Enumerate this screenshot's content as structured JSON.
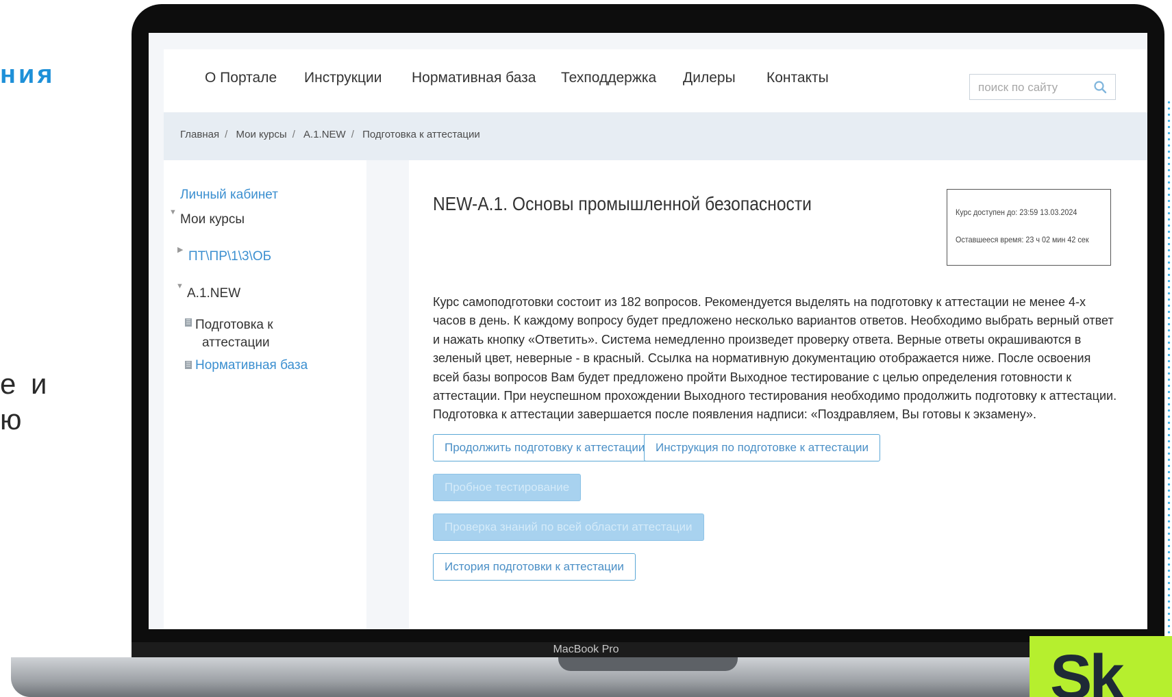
{
  "slide": {
    "fragment_top": "ния",
    "fragment_mid_line1": "е и",
    "fragment_mid_line2": "ю",
    "macbook_label": "MacBook Pro",
    "logo_text": "Sk"
  },
  "nav": {
    "items": [
      "О Портале",
      "Инструкции",
      "Нормативная база",
      "Техподдержка",
      "Дилеры",
      "Контакты"
    ],
    "search_placeholder": "поиск по сайту"
  },
  "breadcrumb": [
    "Главная",
    "Мои курсы",
    "А.1.NEW",
    "Подготовка к аттестации"
  ],
  "sidebar": {
    "cabinet": "Личный кабинет",
    "my_courses": "Мои курсы",
    "course_1": "ПТ\\ПР\\1\\3\\ОБ",
    "course_2": "А.1.NEW",
    "item_prep_line1": "Подготовка к",
    "item_prep_line2": "аттестации",
    "item_normative": "Нормативная база"
  },
  "main": {
    "title": "NEW-А.1. Основы промышленной безопасности",
    "available_until": "Курс доступен до: 23:59 13.03.2024",
    "remaining_time": "Оставшееся время: 23 ч 02 мин 42 сек",
    "description": "Курс самоподготовки состоит из 182 вопросов. Рекомендуется выделять на подготовку к аттестации не менее 4-х часов в день. К каждому вопросу будет предложено несколько вариантов ответов. Необходимо выбрать верный ответ и нажать кнопку «Ответить». Система немедленно произведет проверку ответа. Верные ответы окрашиваются в зеленый цвет, неверные - в красный. Ссылка на нормативную документацию отображается ниже. После освоения всей базы вопросов Вам будет предложено пройти Выходное тестирование с целью определения готовности к аттестации. При неуспешном прохождении Выходного тестирования необходимо продолжить подготовку к аттестации. Подготовка к аттестации завершается после появления надписи: «Поздравляем, Вы готовы к экзамену».",
    "btn_continue": "Продолжить подготовку к аттестации",
    "btn_instruction": "Инструкция по подготовке к аттестации",
    "btn_trial": "Пробное тестирование",
    "btn_check_all": "Проверка знаний по всей области аттестации",
    "btn_history": "История подготовки к аттестации"
  },
  "colors": {
    "accent": "#4a8fc6",
    "link": "#3b8fd0",
    "logo_bg": "#b6ef2e"
  }
}
